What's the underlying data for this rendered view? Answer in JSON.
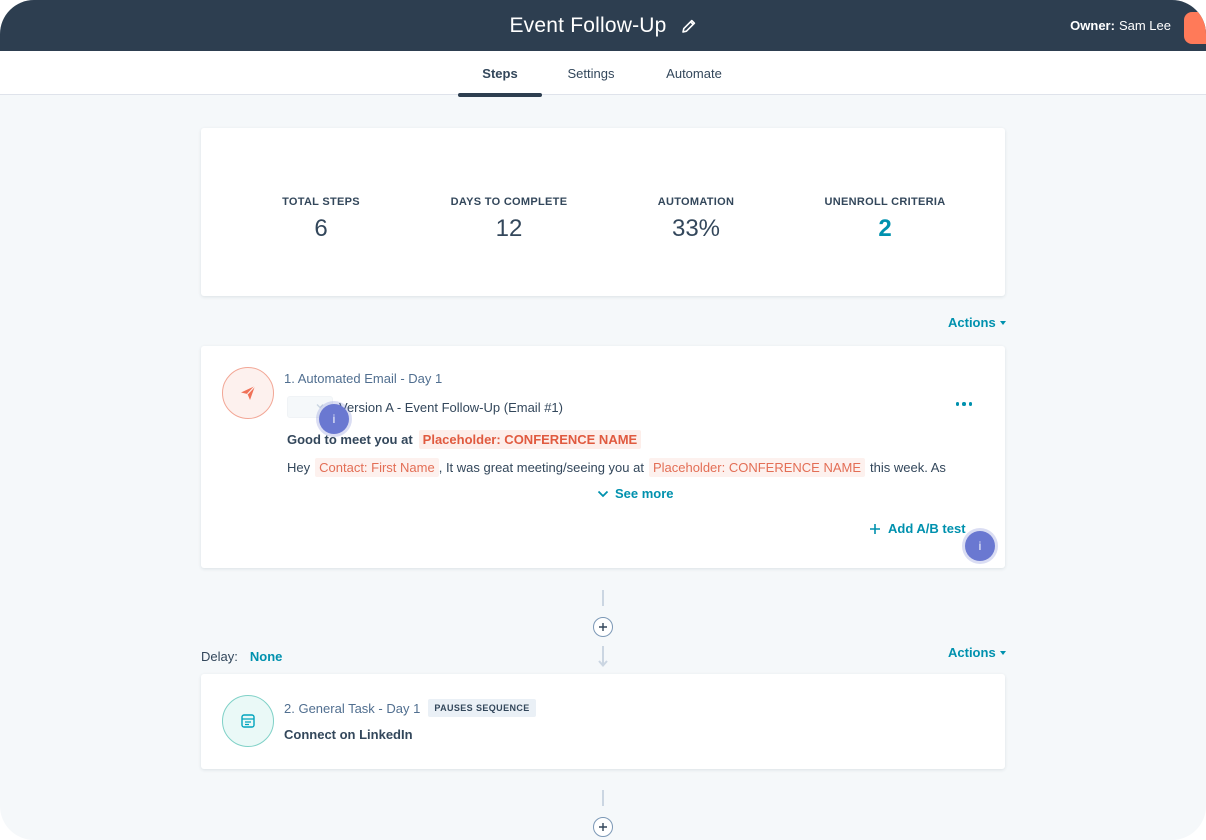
{
  "header": {
    "title": "Event Follow-Up",
    "owner_label": "Owner:",
    "owner_name": "Sam Lee"
  },
  "tabs": [
    {
      "label": "Steps",
      "active": true
    },
    {
      "label": "Settings",
      "active": false
    },
    {
      "label": "Automate",
      "active": false
    }
  ],
  "stats": [
    {
      "label": "TOTAL STEPS",
      "value": "6"
    },
    {
      "label": "DAYS TO COMPLETE",
      "value": "12"
    },
    {
      "label": "AUTOMATION",
      "value": "33%"
    },
    {
      "label": "UNENROLL CRITERIA",
      "value": "2"
    }
  ],
  "actions_label": "Actions",
  "step1": {
    "title": "1. Automated Email - Day 1",
    "version": "Version A - Event Follow-Up (Email #1)",
    "info_glyph": "i",
    "subject_prefix": "Good to meet you at",
    "subject_token": "Placeholder: CONFERENCE NAME",
    "body_hey": "Hey",
    "body_token_contact": "Contact: First Name",
    "body_mid": ", It was great meeting/seeing you at",
    "body_token_conf": "Placeholder: CONFERENCE NAME",
    "body_end": "this week. As",
    "see_more": "See more",
    "ab_test": "Add A/B test"
  },
  "delay": {
    "label": "Delay:",
    "value": "None"
  },
  "step2": {
    "title": "2. General Task - Day 1",
    "badge": "PAUSES SEQUENCE",
    "task": "Connect on LinkedIn"
  },
  "colors": {
    "header_bg": "#2d3e50",
    "accent": "#0091ae",
    "token": "#e05a3f",
    "info": "#6a78d1"
  }
}
